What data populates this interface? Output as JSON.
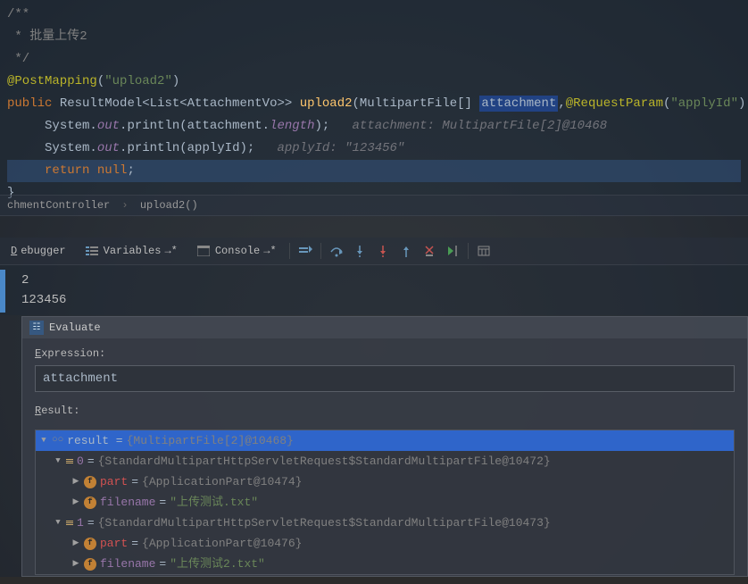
{
  "code": {
    "comment1": "/**",
    "comment2": " * 批量上传2",
    "comment3": " */",
    "anno_postmapping": "@PostMapping",
    "postmapping_path": "\"upload2\"",
    "kw_public": "public",
    "rtype": "ResultModel<List<AttachmentVo>>",
    "method_name": "upload2",
    "sig_open": "(MultipartFile[] ",
    "param_attachment": "attachment",
    "anno_reqparam": "@RequestParam",
    "reqparam_val": "\"applyId\"",
    "sig_rest": ") Strin",
    "sys": "System.",
    "out": "out",
    "println1": ".println(attachment.",
    "length": "length",
    "println1_end": ");",
    "println2": ".println(applyId);",
    "hint1": "attachment: MultipartFile[2]@10468",
    "hint2": "applyId: \"123456\"",
    "kw_return": "return ",
    "kw_null": "null",
    "semicolon": ";",
    "rbrace": "}"
  },
  "breadcrumb": {
    "item1": "chmentController",
    "item2": "upload2()"
  },
  "debugger": {
    "tab_debugger": "Debugger",
    "tab_variables": "Variables",
    "tab_console": "Console",
    "d_under": "D",
    "ebugger": "ebugger"
  },
  "console": {
    "line1": "2",
    "line2": "123456"
  },
  "evaluate": {
    "title": "Evaluate",
    "expr_label_e": "E",
    "expr_label_rest": "xpression:",
    "expr_value": "attachment",
    "result_label_r": "R",
    "result_label_rest": "esult:",
    "tree": {
      "root_prefix": "result = ",
      "root_val": "{MultipartFile[2]@10468}",
      "i0": "0",
      "i0_val": "{StandardMultipartHttpServletRequest$StandardMultipartFile@10472}",
      "i0_part": "part",
      "i0_part_val": "{ApplicationPart@10474}",
      "i0_fn": "filename",
      "i0_fn_val": "\"上传测试.txt\"",
      "i1": "1",
      "i1_val": "{StandardMultipartHttpServletRequest$StandardMultipartFile@10473}",
      "i1_part": "part",
      "i1_part_val": "{ApplicationPart@10476}",
      "i1_fn": "filename",
      "i1_fn_val": "\"上传测试2.txt\""
    }
  }
}
